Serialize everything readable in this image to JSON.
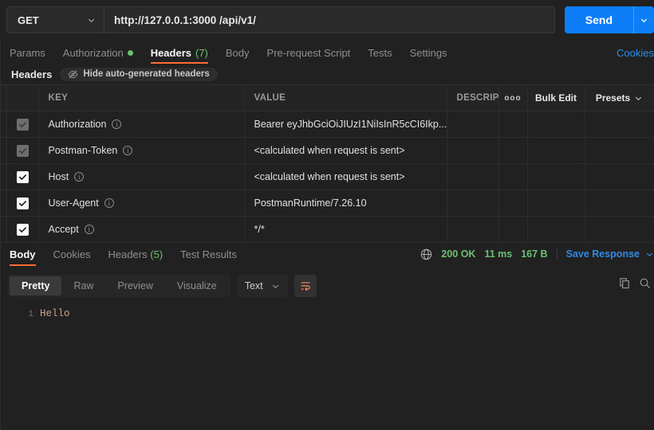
{
  "request": {
    "method": "GET",
    "url": "http://127.0.0.1:3000 /api/v1/",
    "send_label": "Send",
    "tabs": [
      {
        "label": "Params",
        "active": false,
        "dot": false,
        "count": ""
      },
      {
        "label": "Authorization",
        "active": false,
        "dot": true,
        "count": ""
      },
      {
        "label": "Headers",
        "active": true,
        "dot": false,
        "count": "(7)"
      },
      {
        "label": "Body",
        "active": false,
        "dot": false,
        "count": ""
      },
      {
        "label": "Pre-request Script",
        "active": false,
        "dot": false,
        "count": ""
      },
      {
        "label": "Tests",
        "active": false,
        "dot": false,
        "count": ""
      },
      {
        "label": "Settings",
        "active": false,
        "dot": false,
        "count": ""
      }
    ],
    "cookies_link": "Cookies"
  },
  "headers_section": {
    "title": "Headers",
    "hide_autogen_label": "Hide auto-generated headers",
    "columns": {
      "key": "KEY",
      "value": "VALUE",
      "description": "DESCRIPTI",
      "bulk_edit": "Bulk Edit",
      "presets": "Presets"
    },
    "rows": [
      {
        "checked": true,
        "disabled": true,
        "key": "Authorization",
        "value": "Bearer eyJhbGciOiJIUzI1NiIsInR5cCI6Ikp..."
      },
      {
        "checked": true,
        "disabled": true,
        "key": "Postman-Token",
        "value": "<calculated when request is sent>"
      },
      {
        "checked": true,
        "disabled": false,
        "key": "Host",
        "value": "<calculated when request is sent>"
      },
      {
        "checked": true,
        "disabled": false,
        "key": "User-Agent",
        "value": "PostmanRuntime/7.26.10"
      },
      {
        "checked": true,
        "disabled": false,
        "key": "Accept",
        "value": "*/*"
      }
    ]
  },
  "response": {
    "tabs": [
      {
        "label": "Body",
        "active": true,
        "count": ""
      },
      {
        "label": "Cookies",
        "active": false,
        "count": ""
      },
      {
        "label": "Headers",
        "active": false,
        "count": "(5)"
      },
      {
        "label": "Test Results",
        "active": false,
        "count": ""
      }
    ],
    "status": "200 OK",
    "time": "11 ms",
    "size": "167 B",
    "save_response": "Save Response",
    "view_modes": [
      {
        "label": "Pretty",
        "active": true
      },
      {
        "label": "Raw",
        "active": false
      },
      {
        "label": "Preview",
        "active": false
      },
      {
        "label": "Visualize",
        "active": false
      }
    ],
    "format": "Text",
    "body_lines": [
      {
        "num": "1",
        "text": "Hello"
      }
    ]
  },
  "colors": {
    "accent_orange": "#ff6c37",
    "link_blue": "#2f8ae8",
    "send_blue": "#0d7ef7",
    "status_green": "#6cc070",
    "background": "#212121"
  }
}
